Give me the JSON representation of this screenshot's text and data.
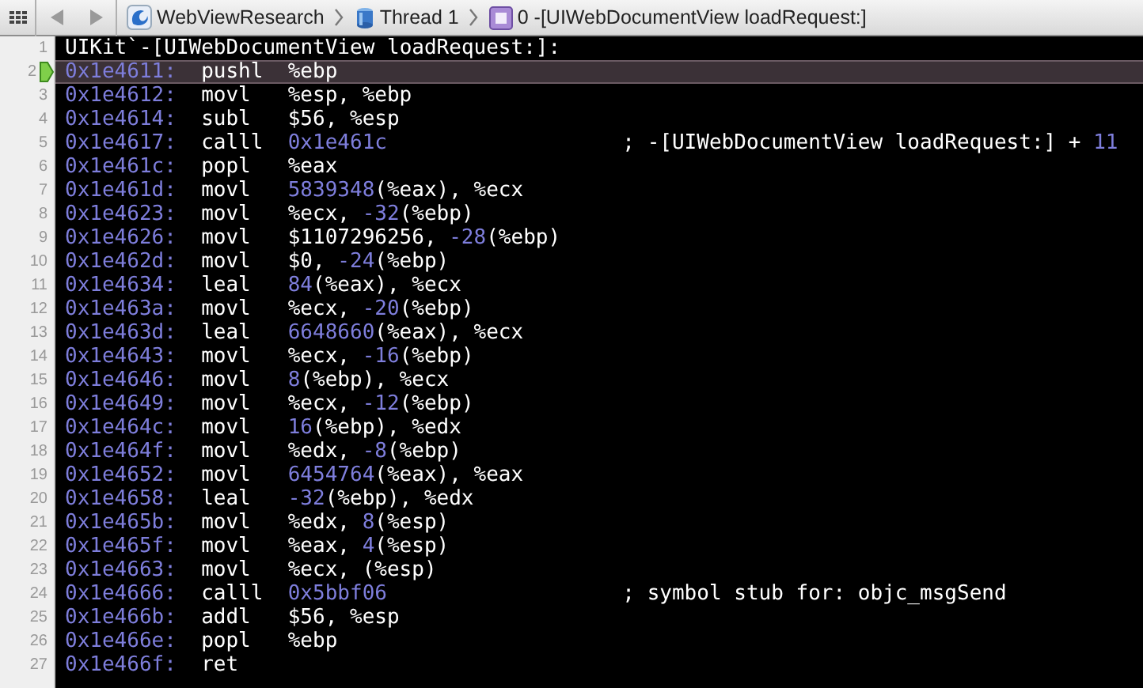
{
  "toolbar": {
    "nav": [
      {
        "kind": "back",
        "disabled": true
      },
      {
        "kind": "forward",
        "disabled": true
      }
    ],
    "breadcrumbs": [
      {
        "kind": "app",
        "label": "WebViewResearch"
      },
      {
        "kind": "thread",
        "label": "Thread 1"
      },
      {
        "kind": "frame",
        "label": "0 -[UIWebDocumentView loadRequest:]"
      }
    ]
  },
  "editor": {
    "lines": [
      {
        "number": "1",
        "kind": "header",
        "text": "UIKit`-[UIWebDocumentView loadRequest:]:",
        "selected": false
      },
      {
        "number": "2",
        "kind": "instruction",
        "address": "0x1e4611:",
        "mnemonic": "pushl",
        "operands": "%ebp",
        "selected": true
      },
      {
        "number": "3",
        "kind": "instruction",
        "address": "0x1e4612:",
        "mnemonic": "movl",
        "operands": "%esp, %ebp",
        "selected": false
      },
      {
        "number": "4",
        "kind": "instruction",
        "address": "0x1e4614:",
        "mnemonic": "subl",
        "operands": "$56, %esp",
        "selected": false
      },
      {
        "number": "5",
        "kind": "instruction",
        "address": "0x1e4617:",
        "mnemonic": "calll",
        "operands": "0x1e461c",
        "comment": "; -[UIWebDocumentView loadRequest:] + 11",
        "selected": false
      },
      {
        "number": "6",
        "kind": "instruction",
        "address": "0x1e461c:",
        "mnemonic": "popl",
        "operands": "%eax",
        "selected": false
      },
      {
        "number": "7",
        "kind": "instruction",
        "address": "0x1e461d:",
        "mnemonic": "movl",
        "operands": "5839348(%eax), %ecx",
        "selected": false
      },
      {
        "number": "8",
        "kind": "instruction",
        "address": "0x1e4623:",
        "mnemonic": "movl",
        "operands": "%ecx, -32(%ebp)",
        "selected": false
      },
      {
        "number": "9",
        "kind": "instruction",
        "address": "0x1e4626:",
        "mnemonic": "movl",
        "operands": "$1107296256, -28(%ebp)",
        "selected": false
      },
      {
        "number": "10",
        "kind": "instruction",
        "address": "0x1e462d:",
        "mnemonic": "movl",
        "operands": "$0, -24(%ebp)",
        "selected": false
      },
      {
        "number": "11",
        "kind": "instruction",
        "address": "0x1e4634:",
        "mnemonic": "leal",
        "operands": "84(%eax), %ecx",
        "selected": false
      },
      {
        "number": "12",
        "kind": "instruction",
        "address": "0x1e463a:",
        "mnemonic": "movl",
        "operands": "%ecx, -20(%ebp)",
        "selected": false
      },
      {
        "number": "13",
        "kind": "instruction",
        "address": "0x1e463d:",
        "mnemonic": "leal",
        "operands": "6648660(%eax), %ecx",
        "selected": false
      },
      {
        "number": "14",
        "kind": "instruction",
        "address": "0x1e4643:",
        "mnemonic": "movl",
        "operands": "%ecx, -16(%ebp)",
        "selected": false
      },
      {
        "number": "15",
        "kind": "instruction",
        "address": "0x1e4646:",
        "mnemonic": "movl",
        "operands": "8(%ebp), %ecx",
        "selected": false
      },
      {
        "number": "16",
        "kind": "instruction",
        "address": "0x1e4649:",
        "mnemonic": "movl",
        "operands": "%ecx, -12(%ebp)",
        "selected": false
      },
      {
        "number": "17",
        "kind": "instruction",
        "address": "0x1e464c:",
        "mnemonic": "movl",
        "operands": "16(%ebp), %edx",
        "selected": false
      },
      {
        "number": "18",
        "kind": "instruction",
        "address": "0x1e464f:",
        "mnemonic": "movl",
        "operands": "%edx, -8(%ebp)",
        "selected": false
      },
      {
        "number": "19",
        "kind": "instruction",
        "address": "0x1e4652:",
        "mnemonic": "movl",
        "operands": "6454764(%eax), %eax",
        "selected": false
      },
      {
        "number": "20",
        "kind": "instruction",
        "address": "0x1e4658:",
        "mnemonic": "leal",
        "operands": "-32(%ebp), %edx",
        "selected": false
      },
      {
        "number": "21",
        "kind": "instruction",
        "address": "0x1e465b:",
        "mnemonic": "movl",
        "operands": "%edx, 8(%esp)",
        "selected": false
      },
      {
        "number": "22",
        "kind": "instruction",
        "address": "0x1e465f:",
        "mnemonic": "movl",
        "operands": "%eax, 4(%esp)",
        "selected": false
      },
      {
        "number": "23",
        "kind": "instruction",
        "address": "0x1e4663:",
        "mnemonic": "movl",
        "operands": "%ecx, (%esp)",
        "selected": false
      },
      {
        "number": "24",
        "kind": "instruction",
        "address": "0x1e4666:",
        "mnemonic": "calll",
        "operands": "0x5bbf06",
        "comment": "; symbol stub for: objc_msgSend",
        "selected": false
      },
      {
        "number": "25",
        "kind": "instruction",
        "address": "0x1e466b:",
        "mnemonic": "addl",
        "operands": "$56, %esp",
        "selected": false
      },
      {
        "number": "26",
        "kind": "instruction",
        "address": "0x1e466e:",
        "mnemonic": "popl",
        "operands": "%ebp",
        "selected": false
      },
      {
        "number": "27",
        "kind": "instruction",
        "address": "0x1e466f:",
        "mnemonic": "ret",
        "selected": false
      }
    ]
  }
}
